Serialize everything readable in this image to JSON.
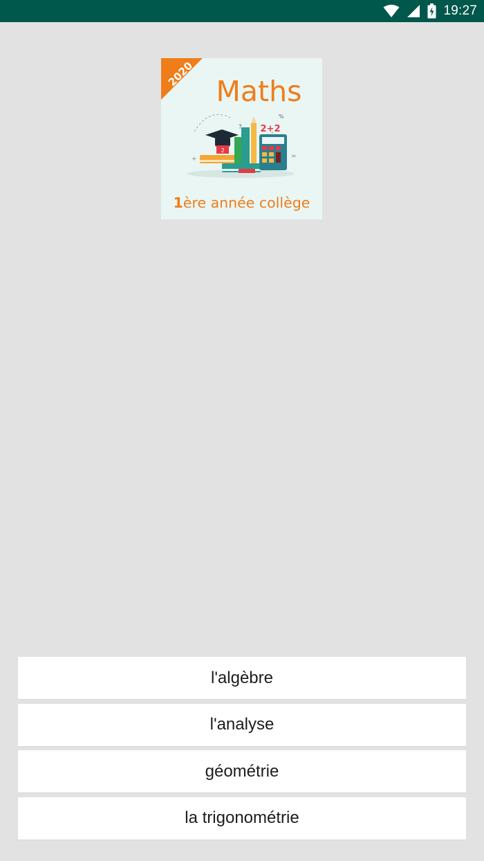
{
  "status_bar": {
    "time": "19:27",
    "icons": [
      "wifi-icon",
      "signal-icon",
      "battery-charging-icon"
    ],
    "color": "#00574b"
  },
  "logo": {
    "year": "2020",
    "title": "Maths",
    "subtitle_number": "1",
    "subtitle_rest": "ère année collège",
    "accent_color": "#ef7d1a"
  },
  "menu": {
    "items": [
      {
        "label": "l'algèbre"
      },
      {
        "label": "l'analyse"
      },
      {
        "label": "géométrie"
      },
      {
        "label": "la trigonométrie"
      }
    ]
  }
}
